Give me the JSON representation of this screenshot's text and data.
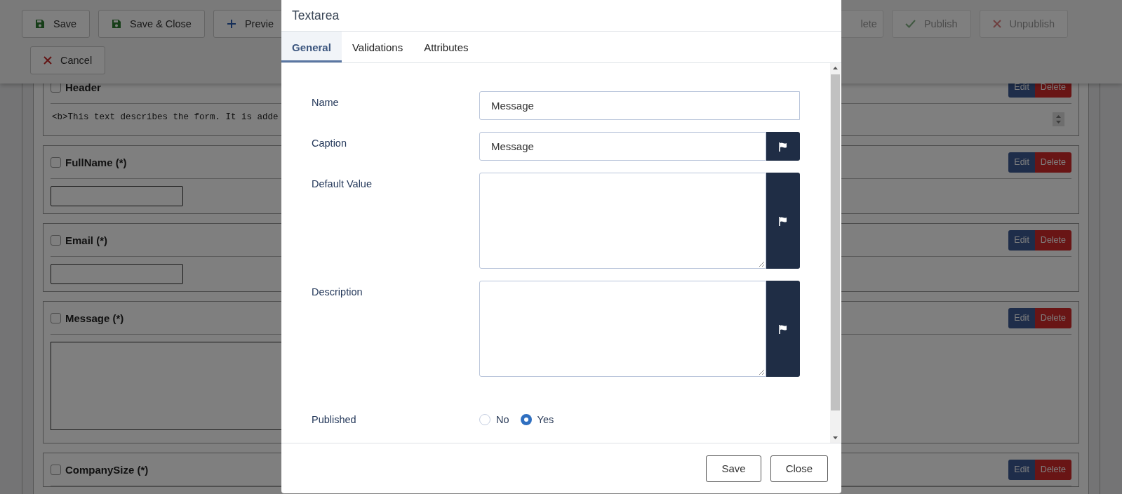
{
  "toolbar": {
    "row_1_left": [
      {
        "kind": "save",
        "label": "Save",
        "disabled": false
      },
      {
        "kind": "save",
        "label": "Save & Close",
        "disabled": false
      },
      {
        "kind": "plus",
        "label": "Previe",
        "disabled": false
      }
    ],
    "row_1_right": [
      {
        "kind": "none",
        "label": "lete",
        "disabled": true
      },
      {
        "kind": "check",
        "label": "Publish",
        "disabled": true
      },
      {
        "kind": "cross",
        "label": "Unpublish",
        "disabled": true
      }
    ],
    "row_2": [
      {
        "kind": "cross",
        "label": "Cancel",
        "disabled": false
      }
    ]
  },
  "form_fields": [
    {
      "kind": "header",
      "label": "Header",
      "checked": false,
      "content": "<b>This text describes the form. It is adde",
      "edit": "Edit",
      "delete": "Delete"
    },
    {
      "kind": "text",
      "label": "FullName (*)",
      "checked": false,
      "edit": "Edit",
      "delete": "Delete"
    },
    {
      "kind": "text",
      "label": "Email (*)",
      "checked": false,
      "edit": "Edit",
      "delete": "Delete"
    },
    {
      "kind": "textarea",
      "label": "Message (*)",
      "checked": false,
      "edit": "Edit",
      "delete": "Delete"
    },
    {
      "kind": "cut",
      "label": "CompanySize (*)",
      "checked": false,
      "edit": "Edit",
      "delete": "Delete"
    }
  ],
  "modal": {
    "title": "Textarea",
    "tabs": [
      {
        "label": "General",
        "selected": true
      },
      {
        "label": "Validations",
        "selected": false
      },
      {
        "label": "Attributes",
        "selected": false
      }
    ],
    "fields": [
      {
        "kind": "input",
        "label": "Name",
        "value": "Message"
      },
      {
        "kind": "input_translatable",
        "label": "Caption",
        "value": "Message"
      },
      {
        "kind": "textarea_translatable",
        "label": "Default Value"
      },
      {
        "kind": "textarea_translatable",
        "label": "Description"
      },
      {
        "kind": "radio",
        "label": "Published",
        "options": [
          {
            "label": "No",
            "selected": false
          },
          {
            "label": "Yes",
            "selected": true
          }
        ]
      }
    ],
    "buttons": [
      "Save",
      "Close"
    ]
  }
}
